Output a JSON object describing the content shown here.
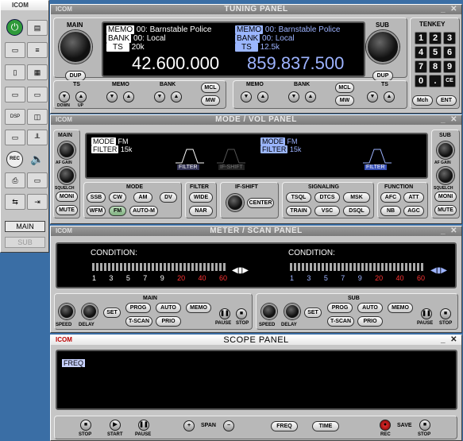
{
  "tuning": {
    "title": "TUNING PANEL",
    "main_label": "MAIN",
    "sub_label": "SUB",
    "tenkey_label": "TENKEY",
    "main": {
      "memo_tag": "MEMO",
      "memo": "00: Barnstable Police",
      "bank_tag": "BANK",
      "bank": "00: Local",
      "ts_tag": "TS",
      "ts": "20k",
      "freq": "42.600.000"
    },
    "sub": {
      "memo_tag": "MEMO",
      "memo": "00: Barnstable Police",
      "bank_tag": "BANK",
      "bank": "00: Local",
      "ts_tag": "TS",
      "ts": "12.5k",
      "freq": "859.837.500"
    },
    "buttons": {
      "dup": "DUP",
      "mcl": "MCL",
      "mw": "MW",
      "mch": "Mch",
      "ent": "ENT"
    },
    "group_labels": {
      "ts": "TS",
      "memo": "MEMO",
      "bank": "BANK",
      "down": "DOWN",
      "up": "UP"
    },
    "keys": [
      "1",
      "2",
      "3",
      "4",
      "5",
      "6",
      "7",
      "8",
      "9",
      "0",
      ".",
      "CE"
    ]
  },
  "mode": {
    "title": "MODE / VOL PANEL",
    "main_label": "MAIN",
    "sub_label": "SUB",
    "af": "AF GAIN",
    "squelch": "SQUELCH",
    "moni": "MONI",
    "mute": "MUTE",
    "main_mode_tag": "MODE",
    "main_mode": "FM",
    "main_filter_tag": "FILTER",
    "main_filter": "15k",
    "sub_mode_tag": "MODE",
    "sub_mode": "FM",
    "sub_filter_tag": "FILTER",
    "sub_filter": "15k",
    "filter_disp": "FILTER",
    "ifshift_disp": "IF-SHIFT",
    "mode_label": "MODE",
    "modes": [
      "SSB",
      "CW",
      "AM",
      "DV",
      "WFM",
      "FM",
      "AUTO-M"
    ],
    "filter_label": "FILTER",
    "filters": [
      "WIDE",
      "NAR"
    ],
    "ifshift_label": "IF-SHIFT",
    "center": "CENTER",
    "sig_label": "SIGNALING",
    "signaling": [
      "TSQL",
      "DTCS",
      "MSK",
      "TRAIN",
      "VSC",
      "DSQL"
    ],
    "func_label": "FUNCTION",
    "functions": [
      "AFC",
      "ATT",
      "NB",
      "AGC"
    ]
  },
  "meter": {
    "title": "METER / SCAN PANEL",
    "condition": "CONDITION:",
    "scale": [
      "1",
      "3",
      "5",
      "7",
      "9",
      "20",
      "40",
      "60"
    ],
    "main_label": "MAIN",
    "sub_label": "SUB",
    "speed": "SPEED",
    "delay": "DELAY",
    "set": "SET",
    "prog": "PROG",
    "auto": "AUTO",
    "memo": "MEMO",
    "tscan": "T-SCAN",
    "prio": "PRIO",
    "pause": "PAUSE",
    "stop": "STOP"
  },
  "scope": {
    "title": "SCOPE PANEL",
    "freq_tag": "FREQ",
    "stop": "STOP",
    "start": "START",
    "pause": "PAUSE",
    "span": "SPAN",
    "freq": "FREQ",
    "time": "TIME",
    "rec": "REC",
    "save": "SAVE",
    "stop2": "STOP"
  },
  "launcher": {
    "main": "MAIN",
    "sub": "SUB"
  },
  "logo": "ICOM"
}
